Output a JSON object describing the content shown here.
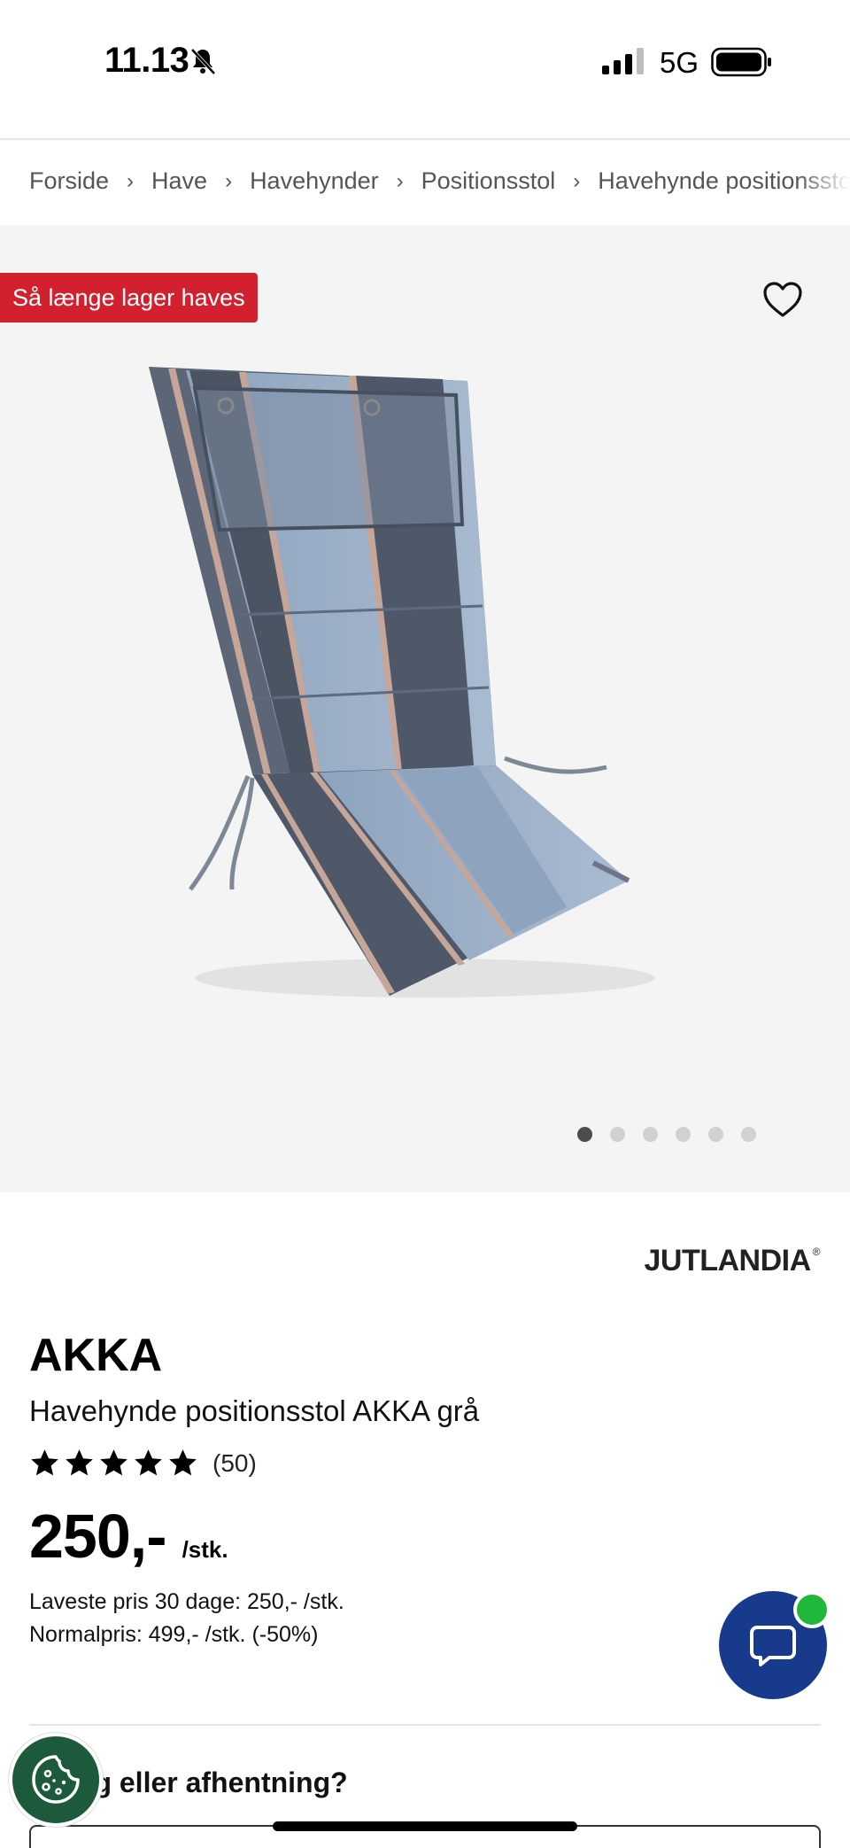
{
  "status_bar": {
    "time": "11.13",
    "network": "5G"
  },
  "breadcrumb": {
    "items": [
      "Forside",
      "Have",
      "Havehynder",
      "Positionsstol",
      "Havehynde positionsstol AKKA grå"
    ]
  },
  "gallery": {
    "badge": "Så længe lager haves",
    "image_count": 6,
    "active_image": 1,
    "accent_color": "#d2202f"
  },
  "product": {
    "brand_logo": "JUTLANDIA",
    "brand_logo_mark": "®",
    "brand": "AKKA",
    "title": "Havehynde positionsstol AKKA grå",
    "rating_stars": 5,
    "review_count": "(50)",
    "price": "250,-",
    "price_unit": "/stk.",
    "lowest_price_note": "Laveste pris 30 dage: 250,- /stk.",
    "normal_price_note": "Normalpris: 499,- /stk. (-50%)"
  },
  "delivery": {
    "heading": "ing eller afhentning?"
  },
  "icons": {
    "wishlist": "heart-icon",
    "chat": "chat-bubble-icon",
    "cookie": "cookie-icon",
    "star": "star-icon"
  },
  "colors": {
    "chat_button": "#173a8c",
    "online_indicator": "#1fb83a",
    "cookie_button": "#1d5a3c"
  }
}
